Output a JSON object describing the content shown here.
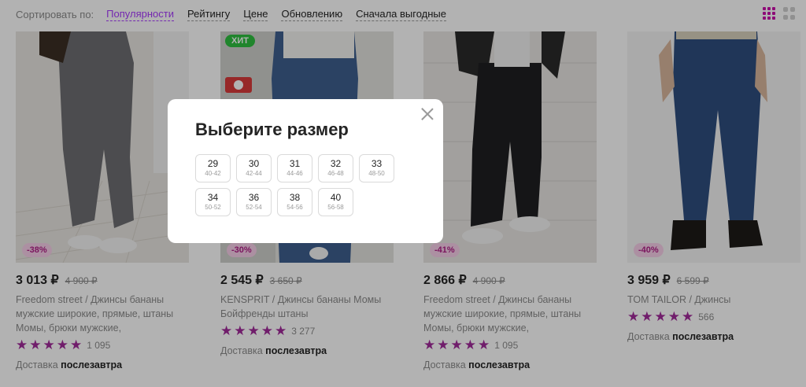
{
  "sort": {
    "label": "Сортировать по:",
    "options": [
      "Популярности",
      "Рейтингу",
      "Цене",
      "Обновлению",
      "Сначала выгодные"
    ],
    "active": "Популярности"
  },
  "view_icons": [
    "grid-3-icon",
    "grid-2-icon"
  ],
  "products": [
    {
      "price": "3 013 ₽",
      "old_price": "4 900 ₽",
      "discount": "-38%",
      "title": "Freedom street / Джинсы бананы мужские широкие, прямые, штаны Момы, брюки мужские, бойфренды,…",
      "rating_count": "1 095",
      "rating": 5,
      "delivery_label": "Доставка",
      "delivery_date": "послезавтра"
    },
    {
      "price": "2 545 ₽",
      "old_price": "3 650 ₽",
      "discount": "-30%",
      "badge": "ХИТ",
      "title": "KENSPRIT / Джинсы бананы Момы Бойфренды штаны",
      "rating_count": "3 277",
      "rating": 5,
      "delivery_label": "Доставка",
      "delivery_date": "послезавтра"
    },
    {
      "price": "2 866 ₽",
      "old_price": "4 900 ₽",
      "discount": "-41%",
      "title": "Freedom street / Джинсы бананы мужские широкие, прямые, штаны Момы, брюки мужские, бойфренды,…",
      "rating_count": "1 095",
      "rating": 5,
      "delivery_label": "Доставка",
      "delivery_date": "послезавтра"
    },
    {
      "price": "3 959 ₽",
      "old_price": "6 599 ₽",
      "discount": "-40%",
      "title": "TOM TAILOR / Джинсы",
      "rating_count": "566",
      "rating": 5,
      "delivery_label": "Доставка",
      "delivery_date": "послезавтра"
    }
  ],
  "modal": {
    "title": "Выберите размер",
    "sizes": [
      {
        "size": "29",
        "ru": "40-42"
      },
      {
        "size": "30",
        "ru": "42-44"
      },
      {
        "size": "31",
        "ru": "44-46"
      },
      {
        "size": "32",
        "ru": "46-48"
      },
      {
        "size": "33",
        "ru": "48-50"
      },
      {
        "size": "34",
        "ru": "50-52"
      },
      {
        "size": "36",
        "ru": "52-54"
      },
      {
        "size": "38",
        "ru": "54-56"
      },
      {
        "size": "40",
        "ru": "56-58"
      }
    ]
  },
  "colors": {
    "accent": "#a73afd",
    "star": "#a12a9a",
    "discount_bg": "#f7cfe8",
    "hit_bg": "#2fbf3f"
  }
}
